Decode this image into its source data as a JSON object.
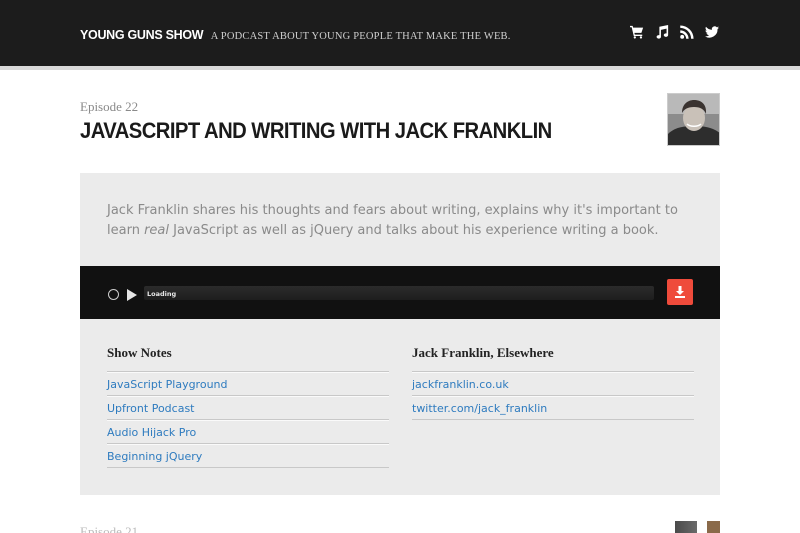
{
  "header": {
    "brand_name": "YOUNG GUNS SHOW",
    "tagline": "A PODCAST ABOUT YOUNG PEOPLE THAT MAKE THE WEB.",
    "background": "#1c1c1c",
    "icons": [
      "cart-icon",
      "music-icon",
      "rss-icon",
      "twitter-icon"
    ]
  },
  "episode": {
    "label": "Episode 22",
    "title": "JAVASCRIPT AND WRITING WITH JACK FRANKLIN",
    "description_before": "Jack Franklin shares his thoughts and fears about writing, explains why it's important to learn ",
    "description_emphasis": "real",
    "description_after": " JavaScript as well as jQuery and talks about his experience writing a book."
  },
  "player": {
    "status": "Loading",
    "download_color": "#ef4b3b"
  },
  "show_notes": {
    "heading": "Show Notes",
    "links": [
      "JavaScript Playground",
      "Upfront Podcast",
      "Audio Hijack Pro",
      "Beginning jQuery"
    ]
  },
  "elsewhere": {
    "heading": "Jack Franklin, Elsewhere",
    "links": [
      "jackfranklin.co.uk",
      "twitter.com/jack_franklin"
    ]
  },
  "next_episode": {
    "label": "Episode 21"
  },
  "colors": {
    "link": "#2e7bbf",
    "panel": "#ebebeb"
  }
}
